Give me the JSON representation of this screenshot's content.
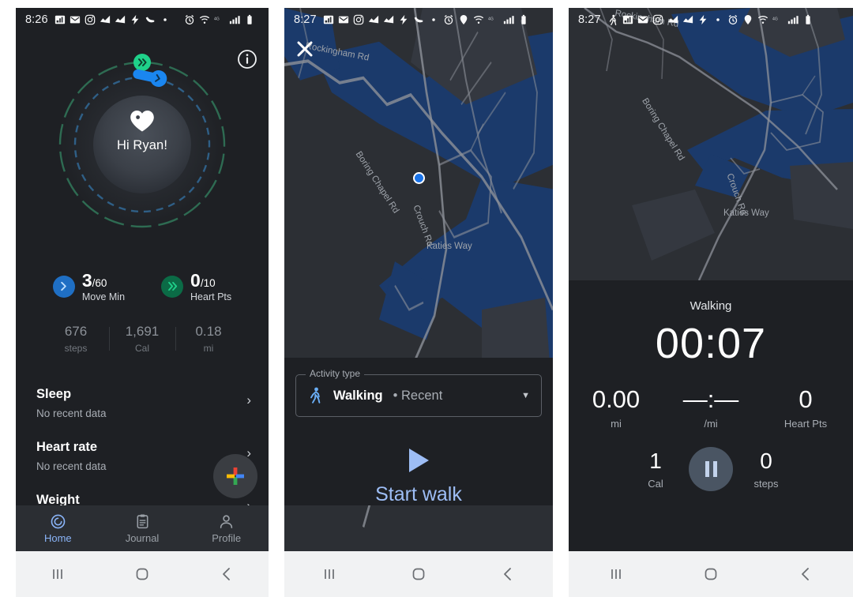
{
  "panels": {
    "home": {
      "status": {
        "time": "8:26",
        "icons": [
          "news-icon",
          "gmail-icon",
          "instagram-icon",
          "chart-icon",
          "chart-icon",
          "flash-icon",
          "shoe-icon",
          "dot-icon",
          "alarm-icon",
          "wifi-icon",
          "network-4g-icon",
          "signal-icon",
          "battery-icon"
        ]
      },
      "info_label": "i",
      "greeting": "Hi Ryan!",
      "goals": [
        {
          "name": "move-min",
          "value": "3",
          "goal": "/60",
          "label": "Move Min",
          "color": "#1f6fc4",
          "icon": "chevron-right-icon"
        },
        {
          "name": "heart-pts",
          "value": "0",
          "goal": "/10",
          "label": "Heart Pts",
          "color": "#0b6b46",
          "icon": "double-chevron-right-icon"
        }
      ],
      "stats": [
        {
          "value": "676",
          "label": "steps"
        },
        {
          "value": "1,691",
          "label": "Cal"
        },
        {
          "value": "0.18",
          "label": "mi"
        }
      ],
      "cards": [
        {
          "title": "Sleep",
          "subtitle": "No recent data",
          "chevron": "›"
        },
        {
          "title": "Heart rate",
          "subtitle": "No recent data",
          "chevron": "›"
        },
        {
          "title": "Weight",
          "subtitle": "",
          "chevron": "›"
        }
      ],
      "fab_label": "add-icon",
      "nav": [
        {
          "label": "Home",
          "icon": "home-spiral-icon",
          "active": true
        },
        {
          "label": "Journal",
          "icon": "clipboard-icon",
          "active": false
        },
        {
          "label": "Profile",
          "icon": "person-icon",
          "active": false
        }
      ]
    },
    "map_start": {
      "status": {
        "time": "8:27"
      },
      "close_label": "close-icon",
      "map_labels": [
        "Rockingham Rd",
        "Boring Chapel Rd",
        "Crouch Rd",
        "Katies Way"
      ],
      "activity_field_label": "Activity type",
      "activity_value": "Walking",
      "activity_sub": "• Recent",
      "start_label": "Start walk"
    },
    "tracking": {
      "status": {
        "time": "8:27"
      },
      "map_labels": [
        "Rockingham Rd",
        "Boring Chapel Rd",
        "Crouch Rd",
        "Katies Way"
      ],
      "activity_name": "Walking",
      "timer": "00:07",
      "metrics_row1": [
        {
          "value": "0.00",
          "label": "mi"
        },
        {
          "value": "—:—",
          "label": "/mi"
        },
        {
          "value": "0",
          "label": "Heart Pts"
        }
      ],
      "metrics_row2": [
        {
          "value": "1",
          "label": "Cal"
        },
        {
          "value": "0",
          "label": "steps"
        }
      ],
      "pause_label": "pause-icon"
    }
  },
  "android_nav": {
    "recents": "recents-icon",
    "home": "home-icon",
    "back": "back-icon"
  },
  "colors": {
    "background": "#1e2024",
    "accent_blue": "#1a73e8",
    "accent_green": "#1fd18a",
    "light_blue": "#9dbdf5",
    "water": "#1b3a6b",
    "nav_bar": "#f1f2f3"
  }
}
